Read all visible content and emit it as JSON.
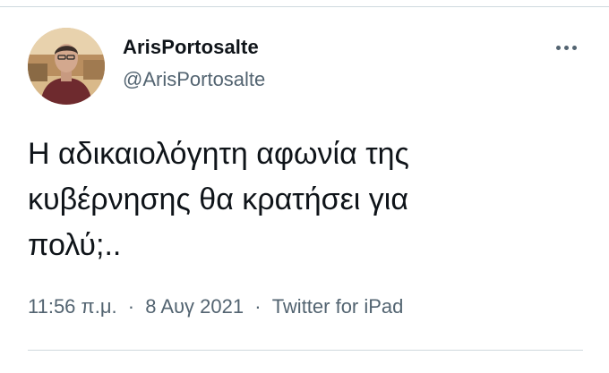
{
  "author": {
    "display_name": "ArisPortosalte",
    "handle": "@ArisPortosalte",
    "avatar_icon": "profile-photo"
  },
  "more_icon": "more-horizontal-icon",
  "tweet": {
    "text": "Η αδικαιολόγητη αφωνία της\nκυβέρνησης θα κρατήσει για\nπολύ;..",
    "time": "11:56 π.μ.",
    "separator": "·",
    "date": "8 Αυγ 2021",
    "source": "Twitter for iPad"
  },
  "colors": {
    "primary_text": "#0f1419",
    "secondary_text": "#536471",
    "divider": "#cfd9de"
  }
}
